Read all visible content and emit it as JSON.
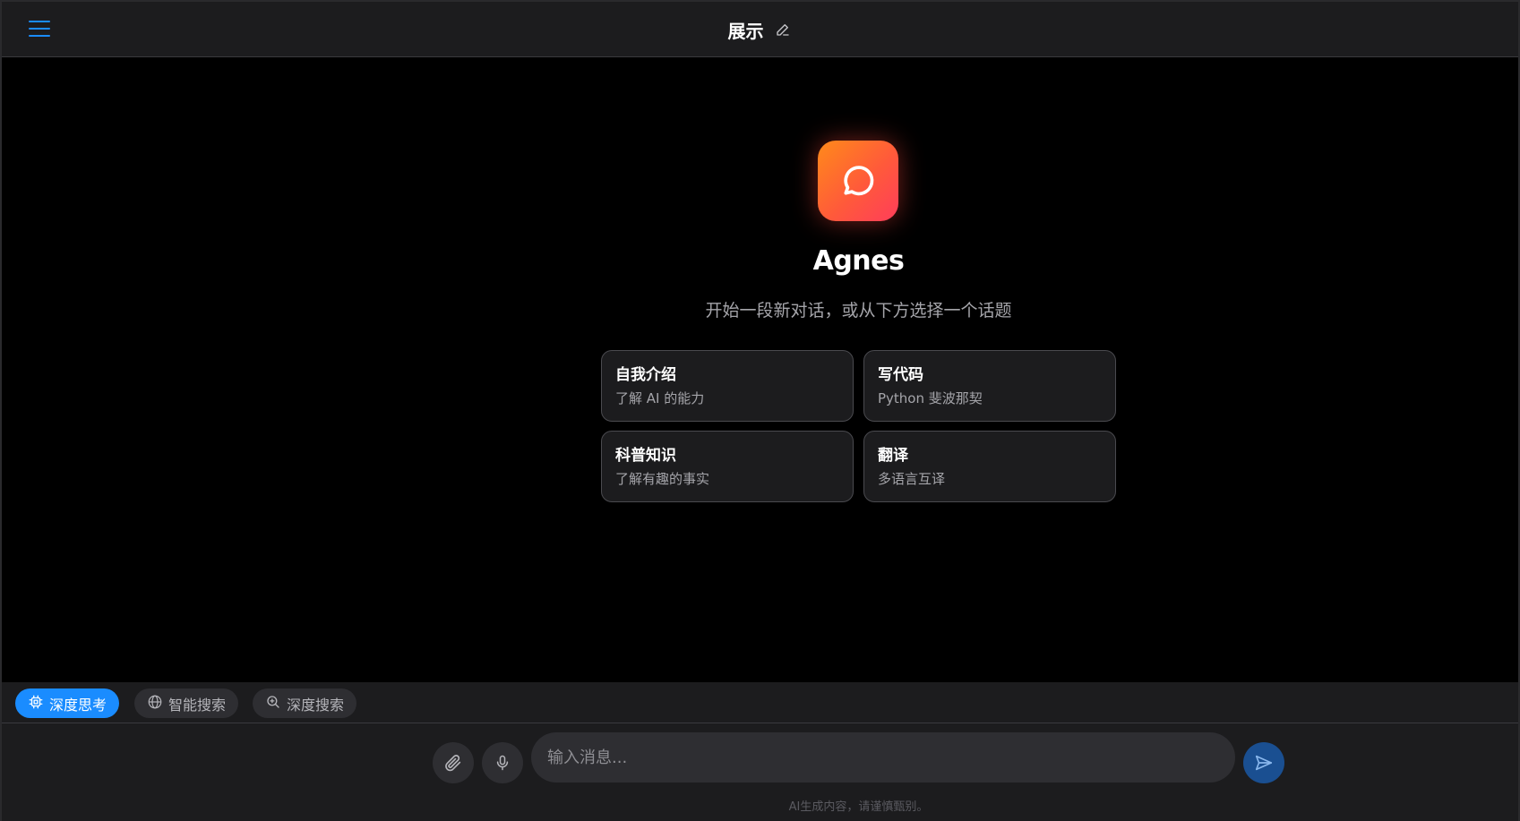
{
  "header": {
    "title": "展示",
    "menu_icon": "menu-icon",
    "edit_icon": "edit-pencil-icon"
  },
  "welcome": {
    "logo_icon": "chat-bubble-icon",
    "app_name": "Agnes",
    "subtitle": "开始一段新对话，或从下方选择一个话题",
    "cards": [
      {
        "title": "自我介绍",
        "desc": "了解 AI 的能力"
      },
      {
        "title": "写代码",
        "desc": "Python 斐波那契"
      },
      {
        "title": "科普知识",
        "desc": "了解有趣的事实"
      },
      {
        "title": "翻译",
        "desc": "多语言互译"
      }
    ]
  },
  "modes": [
    {
      "label": "深度思考",
      "icon": "chip-processor-icon",
      "active": true
    },
    {
      "label": "智能搜索",
      "icon": "globe-icon",
      "active": false
    },
    {
      "label": "深度搜索",
      "icon": "zoom-search-icon",
      "active": false
    }
  ],
  "composer": {
    "placeholder": "输入消息...",
    "attach_icon": "paperclip-icon",
    "mic_icon": "microphone-icon",
    "send_icon": "send-icon",
    "disclaimer": "AI生成内容，请谨慎甄别。"
  },
  "colors": {
    "accent": "#1a8cff",
    "background": "#000000",
    "panel": "#1c1c1e",
    "send_button": "#1a4f91"
  }
}
